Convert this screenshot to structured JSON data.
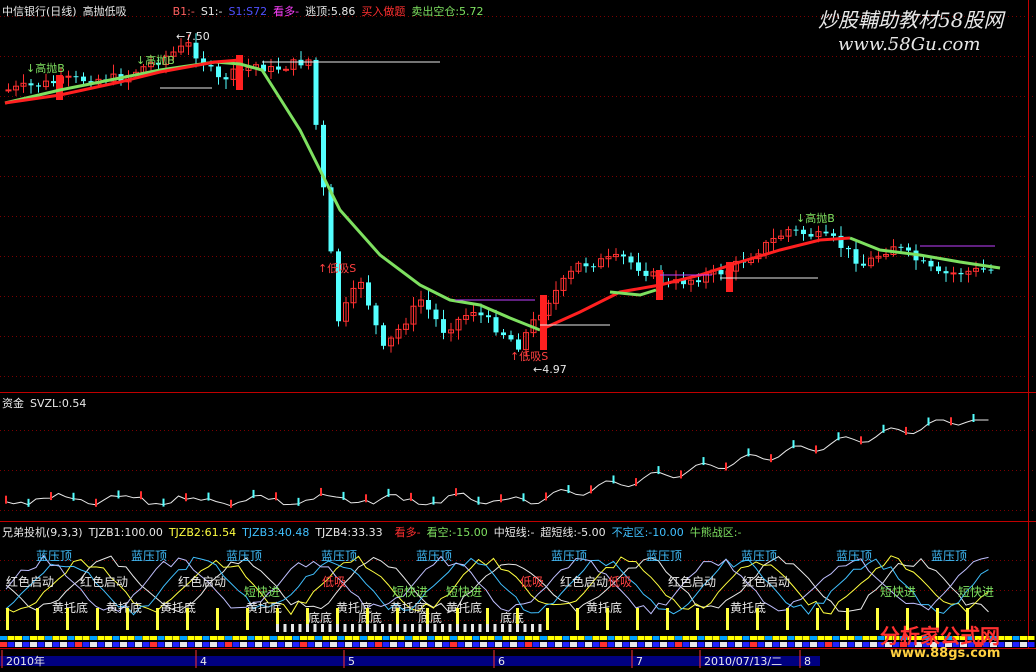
{
  "header_main": {
    "title": "中信银行(日线)",
    "indicator": "高抛低吸",
    "b1": "B1:-",
    "s1": "S1:-",
    "s1b2": "S1:S72",
    "kanduo": "看多-",
    "tuixian": "逃顶:5.86",
    "mairu": "买入做题",
    "maichu": "卖出空仓:5.72"
  },
  "header_fund": {
    "label": "资金",
    "value": "SVZL:0.54"
  },
  "header_sub": {
    "title": "兄弟投机(9,3,3)",
    "t1": "TJZB1:100.00",
    "t2": "TJZB2:61.54",
    "t3": "TJZB3:40.48",
    "t4": "TJZB4:33.33",
    "kd": "看多-",
    "kk": "看空:-15.00",
    "zdx": "中短线:-",
    "cdx": "超短线:-5.00",
    "bdq": "不定区:-10.00",
    "nj": "牛熊战区:-"
  },
  "price_labels": {
    "high": "7.50",
    "low": "4.97",
    "sell1": "高抛B",
    "sell2": "高抛B",
    "sell3": "高抛B",
    "buy1": "低吸S",
    "buy2": "低吸S"
  },
  "sub_labels": {
    "blue_top": [
      "蓝压顶",
      "蓝压顶",
      "蓝压顶",
      "蓝压顶",
      "蓝压顶",
      "蓝压顶",
      "蓝压顶",
      "蓝压顶",
      "蓝压顶",
      "蓝压顶"
    ],
    "red_start": [
      "红色启动",
      "红色启动",
      "红色启动",
      "红色启动",
      "红色启动",
      "红色启动"
    ],
    "yellow_base": [
      "黄托底",
      "黄托底",
      "黄托底",
      "黄托底",
      "黄托底",
      "黄托底",
      "黄托底",
      "黄托底",
      "黄托底"
    ],
    "short_fast": [
      "短快进",
      "短快进",
      "短快进",
      "短快进",
      "短快进"
    ],
    "low_suck": [
      "低吸",
      "低吸",
      "低吸"
    ],
    "bottom": [
      "底底",
      "底底",
      "底底",
      "底底"
    ]
  },
  "date_axis": {
    "labels": [
      "2010年",
      "4",
      "5",
      "6",
      "7",
      "2010/07/13/二",
      "8"
    ]
  },
  "watermark": {
    "top": "炒股輔助教材58股网",
    "top_url": "www.58Gu.com",
    "bottom": "分析家公式网",
    "bottom_url": "www.88gs.com"
  },
  "colors": {
    "up": "#ff3030",
    "down": "#54ffff",
    "ma_green": "#7ee060",
    "ma_red": "#ff2020",
    "grid": "#7a0000",
    "text_white": "#e8e8e8"
  }
}
